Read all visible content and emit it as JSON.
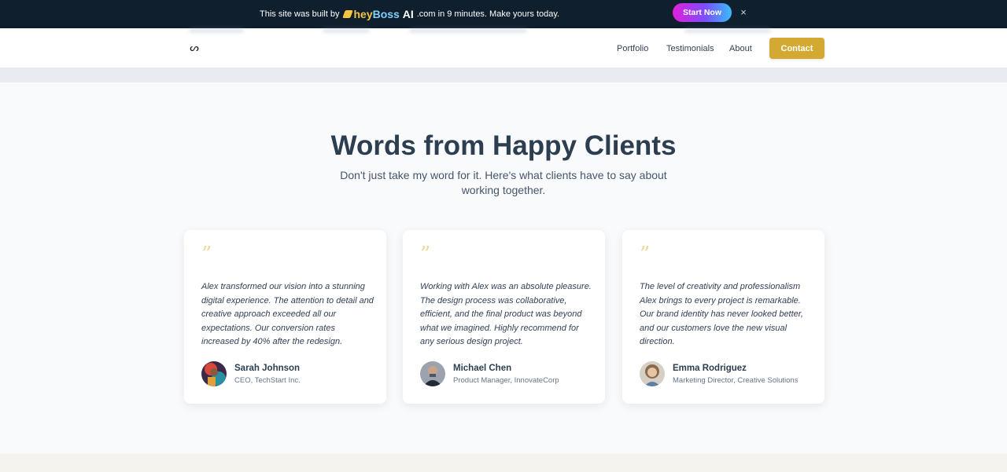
{
  "promo": {
    "text_before": "This site was built by",
    "brand_hey": "hey",
    "brand_boss": "Boss",
    "brand_ai": "AI",
    "text_after": ".com in 9 minutes. Make yours today.",
    "cta_label": "Start Now",
    "close_glyph": "×"
  },
  "header": {
    "logo_glyph": "ᔕ",
    "nav": [
      "Portfolio",
      "Testimonials",
      "About"
    ],
    "contact_label": "Contact",
    "accent_color": "#d4a932"
  },
  "section": {
    "title": "Words from Happy Clients",
    "subtitle": "Don't just take my word for it. Here's what clients have to say about working together."
  },
  "testimonials": [
    {
      "quote_glyph": "”",
      "text": "Alex transformed our vision into a stunning digital experience. The attention to detail and creative approach exceeded all our expectations. Our conversion rates increased by 40% after the redesign.",
      "name": "Sarah Johnson",
      "role": "CEO, TechStart Inc.",
      "avatar_icon": "avatar-photo"
    },
    {
      "quote_glyph": "”",
      "text": "Working with Alex was an absolute pleasure. The design process was collaborative, efficient, and the final product was beyond what we imagined. Highly recommend for any serious design project.",
      "name": "Michael Chen",
      "role": "Product Manager, InnovateCorp",
      "avatar_icon": "avatar-photo"
    },
    {
      "quote_glyph": "”",
      "text": "The level of creativity and professionalism Alex brings to every project is remarkable. Our brand identity has never looked better, and our customers love the new visual direction.",
      "name": "Emma Rodriguez",
      "role": "Marketing Director, Creative Solutions",
      "avatar_icon": "avatar-photo"
    }
  ]
}
